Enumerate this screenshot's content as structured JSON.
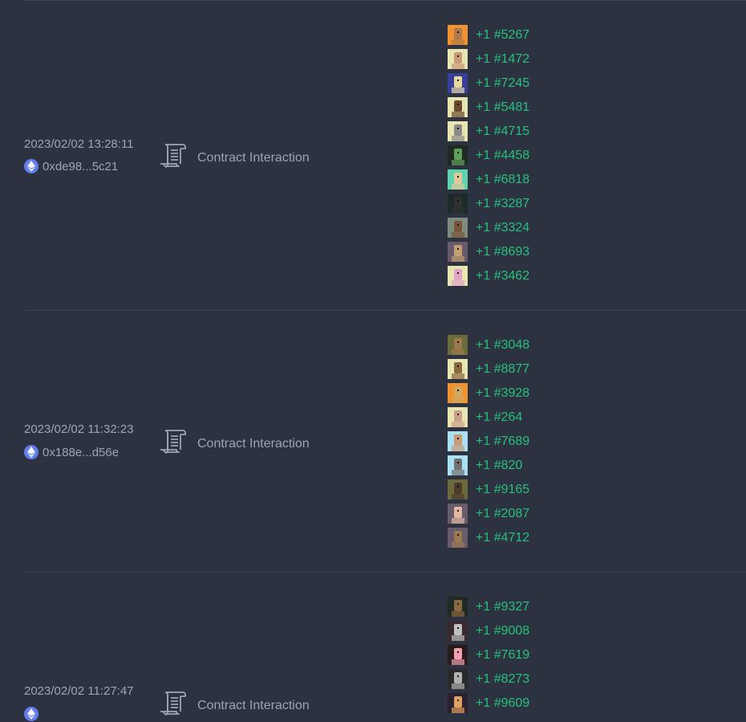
{
  "rows": [
    {
      "timestamp": "2023/02/02 13:28:11",
      "address": "0xde98...5c21",
      "type": "Contract Interaction",
      "tokens": [
        {
          "label": "+1 #5267",
          "bg": "#f0922f",
          "skin": "#b07a4a"
        },
        {
          "label": "+1 #1472",
          "bg": "#e9e5b0",
          "skin": "#c99a78"
        },
        {
          "label": "+1 #7245",
          "bg": "#3b3f9a",
          "skin": "#e8d8a0"
        },
        {
          "label": "+1 #5481",
          "bg": "#e9e5b0",
          "skin": "#6b4a34"
        },
        {
          "label": "+1 #4715",
          "bg": "#e9e5b0",
          "skin": "#8a8a8a"
        },
        {
          "label": "+1 #4458",
          "bg": "#1f2a22",
          "skin": "#5fa05a"
        },
        {
          "label": "+1 #6818",
          "bg": "#5fd3b0",
          "skin": "#e3c99a"
        },
        {
          "label": "+1 #3287",
          "bg": "#1b2b2a",
          "skin": "#303030"
        },
        {
          "label": "+1 #3324",
          "bg": "#7c8c7c",
          "skin": "#7a5338"
        },
        {
          "label": "+1 #8693",
          "bg": "#6a5b6c",
          "skin": "#c2a070"
        },
        {
          "label": "+1 #3462",
          "bg": "#e9e5b0",
          "skin": "#e1a3c8"
        }
      ]
    },
    {
      "timestamp": "2023/02/02 11:32:23",
      "address": "0x188e...d56e",
      "type": "Contract Interaction",
      "tokens": [
        {
          "label": "+1 #3048",
          "bg": "#6c6a3a",
          "skin": "#9c7a50"
        },
        {
          "label": "+1 #8877",
          "bg": "#e9e5b0",
          "skin": "#8a6a40"
        },
        {
          "label": "+1 #3928",
          "bg": "#f0922f",
          "skin": "#d0a860"
        },
        {
          "label": "+1 #264",
          "bg": "#e9e5b0",
          "skin": "#c9a090"
        },
        {
          "label": "+1 #7689",
          "bg": "#a9e1f2",
          "skin": "#c99a78"
        },
        {
          "label": "+1 #820",
          "bg": "#a9e1f2",
          "skin": "#707070"
        },
        {
          "label": "+1 #9165",
          "bg": "#6c6a3a",
          "skin": "#4a3a2a"
        },
        {
          "label": "+1 #2087",
          "bg": "#6a5b6c",
          "skin": "#e0b8a0"
        },
        {
          "label": "+1 #4712",
          "bg": "#6a5b6c",
          "skin": "#9c7a50"
        }
      ]
    },
    {
      "timestamp": "2023/02/02 11:27:47",
      "address": "",
      "type": "Contract Interaction",
      "tokens": [
        {
          "label": "+1 #9327",
          "bg": "#1f2a22",
          "skin": "#8a6a40"
        },
        {
          "label": "+1 #9008",
          "bg": "#3a2a30",
          "skin": "#c0c0c0"
        },
        {
          "label": "+1 #7619",
          "bg": "#2a1a1a",
          "skin": "#f0a0b0"
        },
        {
          "label": "+1 #8273",
          "bg": "#2a2a2a",
          "skin": "#b0b0b0"
        },
        {
          "label": "+1 #9609",
          "bg": "#2a2030",
          "skin": "#e0a060"
        }
      ]
    }
  ]
}
